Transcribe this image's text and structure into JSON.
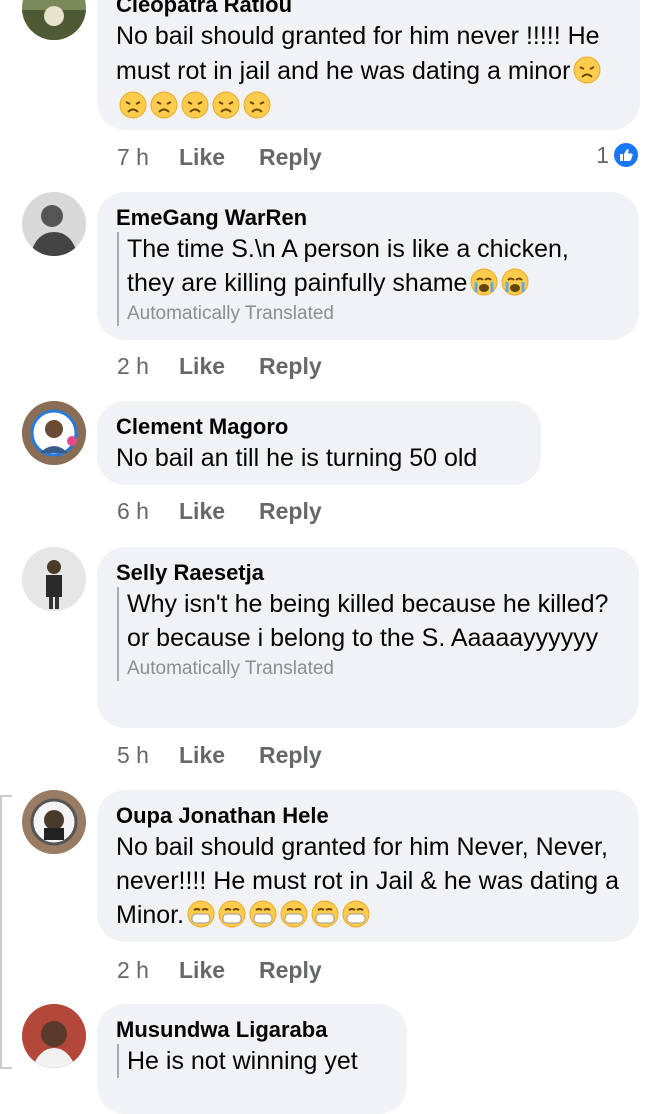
{
  "comments": [
    {
      "author": "Cleopatra Ratlou",
      "text": "No bail should granted for him never !!!!! He must rot in jail and he was dating a minor",
      "emoji": [
        "weary-face",
        "weary-face",
        "weary-face",
        "weary-face",
        "weary-face",
        "weary-face"
      ],
      "translated": "",
      "time": "7 h",
      "like": "Like",
      "reply": "Reply",
      "reaction_count": "1",
      "reaction_icon": "thumbs-up-icon"
    },
    {
      "author": "EmeGang WarRen",
      "text": "The time S.\\n A person is like a chicken, they are killing painfully shame",
      "emoji": [
        "crying-face",
        "crying-face"
      ],
      "translated": "Automatically Translated",
      "time": "2 h",
      "like": "Like",
      "reply": "Reply"
    },
    {
      "author": "Clement Magoro",
      "text": "No bail an till he is turning 50 old",
      "translated": "",
      "time": "6 h",
      "like": "Like",
      "reply": "Reply"
    },
    {
      "author": "Selly Raesetja",
      "text": "Why isn't he being killed because he killed? or because i belong to the S. Aaaaayyyyyy",
      "translated": "Automatically Translated",
      "time": "5 h",
      "like": "Like",
      "reply": "Reply"
    },
    {
      "author": "Oupa Jonathan Hele",
      "text": "No bail should granted for him Never, Never, never!!!! He must rot in Jail & he was dating a Minor.",
      "emoji": [
        "mask-face",
        "mask-face",
        "mask-face",
        "mask-face",
        "mask-face",
        "mask-face"
      ],
      "translated": "",
      "time": "2 h",
      "like": "Like",
      "reply": "Reply"
    },
    {
      "author": "Musundwa Ligaraba",
      "text": "He is not winning yet",
      "translated": ""
    }
  ],
  "colors": {
    "bubble": "#f0f2f5",
    "meta": "#65676b",
    "accent": "#1877f2",
    "emoji_yellow": "#ffcc4d"
  }
}
